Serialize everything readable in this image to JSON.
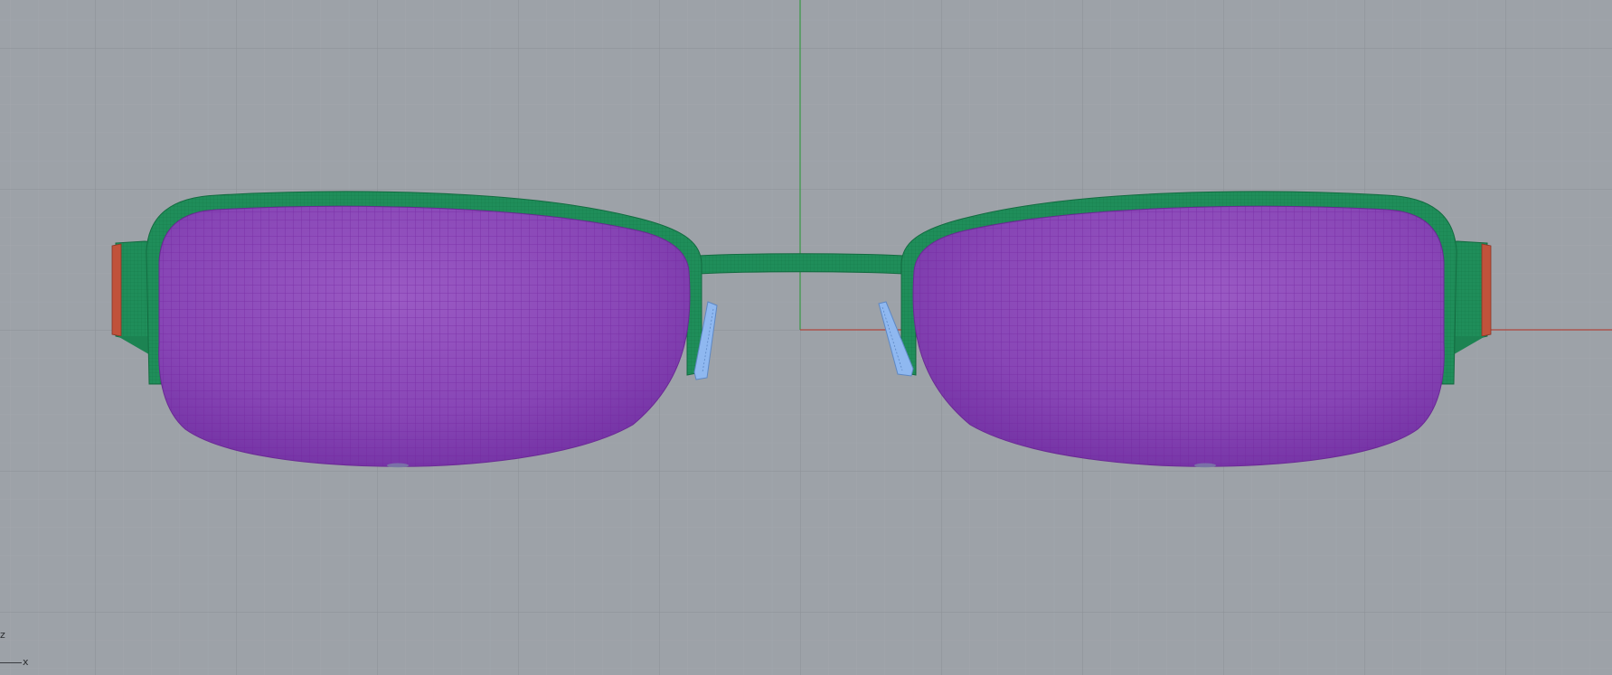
{
  "viewport": {
    "background": "#9da2a8",
    "grid_minor_color": "#a7abb1",
    "grid_major_color": "#8d9197",
    "axis_x_color": "#b0453c",
    "axis_y_color": "#3f9a4c"
  },
  "model": {
    "frame_color": "#1f8e5a",
    "lens_color": "#8a4cb4",
    "lens_wire_color": "#7a2fa4",
    "nose_pad_color": "#8fb8f0",
    "temple_tip_color": "#c0523b"
  },
  "gizmo": {
    "z_label": "z",
    "x_label": "x"
  }
}
